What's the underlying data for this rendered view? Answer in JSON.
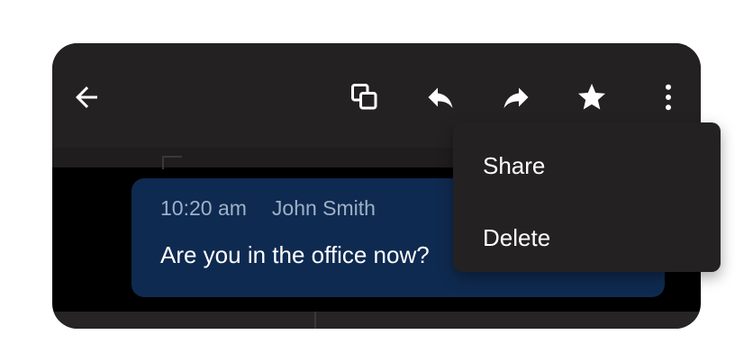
{
  "toolbar": {
    "back_icon": "arrow-left-icon",
    "copy_icon": "copy-icon",
    "reply_icon": "reply-icon",
    "forward_icon": "forward-icon",
    "star_icon": "star-icon",
    "more_icon": "more-vertical-icon",
    "icon_color": "#ffffff",
    "background": "#242122"
  },
  "message": {
    "time": "10:20 am",
    "author": "John Smith",
    "text": "Are you in the office now?",
    "bubble_color": "#0f2a50"
  },
  "menu": {
    "items": [
      {
        "label": "Share"
      },
      {
        "label": "Delete"
      }
    ],
    "background": "#242122"
  }
}
